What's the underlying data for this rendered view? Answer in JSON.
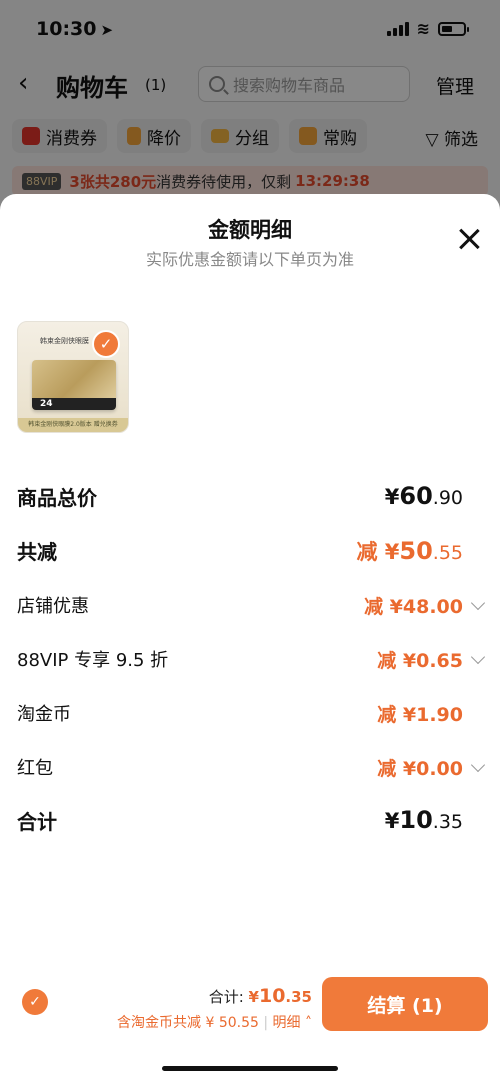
{
  "status_bar": {
    "time": "10:30"
  },
  "background": {
    "title": "购物车",
    "count": "(1)",
    "search_placeholder": "搜索购物车商品",
    "manage": "管理",
    "chips": [
      {
        "label": "消费券",
        "color": "#e0342a"
      },
      {
        "label": "降价",
        "color": "#f0a23a"
      },
      {
        "label": "分组",
        "color": "#f0b341"
      },
      {
        "label": "常购",
        "color": "#f0a23a"
      }
    ],
    "filter": "筛选",
    "coupon": {
      "vip": "88VIP",
      "text_a": "3张共",
      "amount": "280元",
      "text_b": "消费券待使用，仅剩",
      "countdown": "13:29:38"
    }
  },
  "sheet": {
    "title": "金额明细",
    "subtitle": "实际优惠金额请以下单页为准",
    "product": {
      "brand_text": "韩束金刚侠眼膜",
      "card_number": "24",
      "foot_text": "韩束金刚侠眼膜2.0版本 赠兑换券"
    },
    "rows": [
      {
        "label": "商品总价",
        "value_prefix": "¥",
        "value_int": "60",
        "value_dec": ".90"
      },
      {
        "label": "共减",
        "value_prefix": "减 ¥",
        "value_int": "50",
        "value_dec": ".55"
      },
      {
        "label": "店铺优惠",
        "value": "减 ¥48.00"
      },
      {
        "label": "88VIP 专享 9.5 折",
        "value": "减 ¥0.65"
      },
      {
        "label": "淘金币",
        "value": "减 ¥1.90"
      },
      {
        "label": "红包",
        "value": "减 ¥0.00"
      },
      {
        "label": "合计",
        "value_prefix": "¥",
        "value_int": "10",
        "value_dec": ".35"
      }
    ]
  },
  "bottom": {
    "total_label": "合计: ",
    "total_currency": "¥",
    "total_int": "10",
    "total_dec": ".35",
    "discount_note": "含淘金币共减 ¥ 50.55",
    "detail_link": "明细",
    "checkout": "结算 (1)"
  }
}
